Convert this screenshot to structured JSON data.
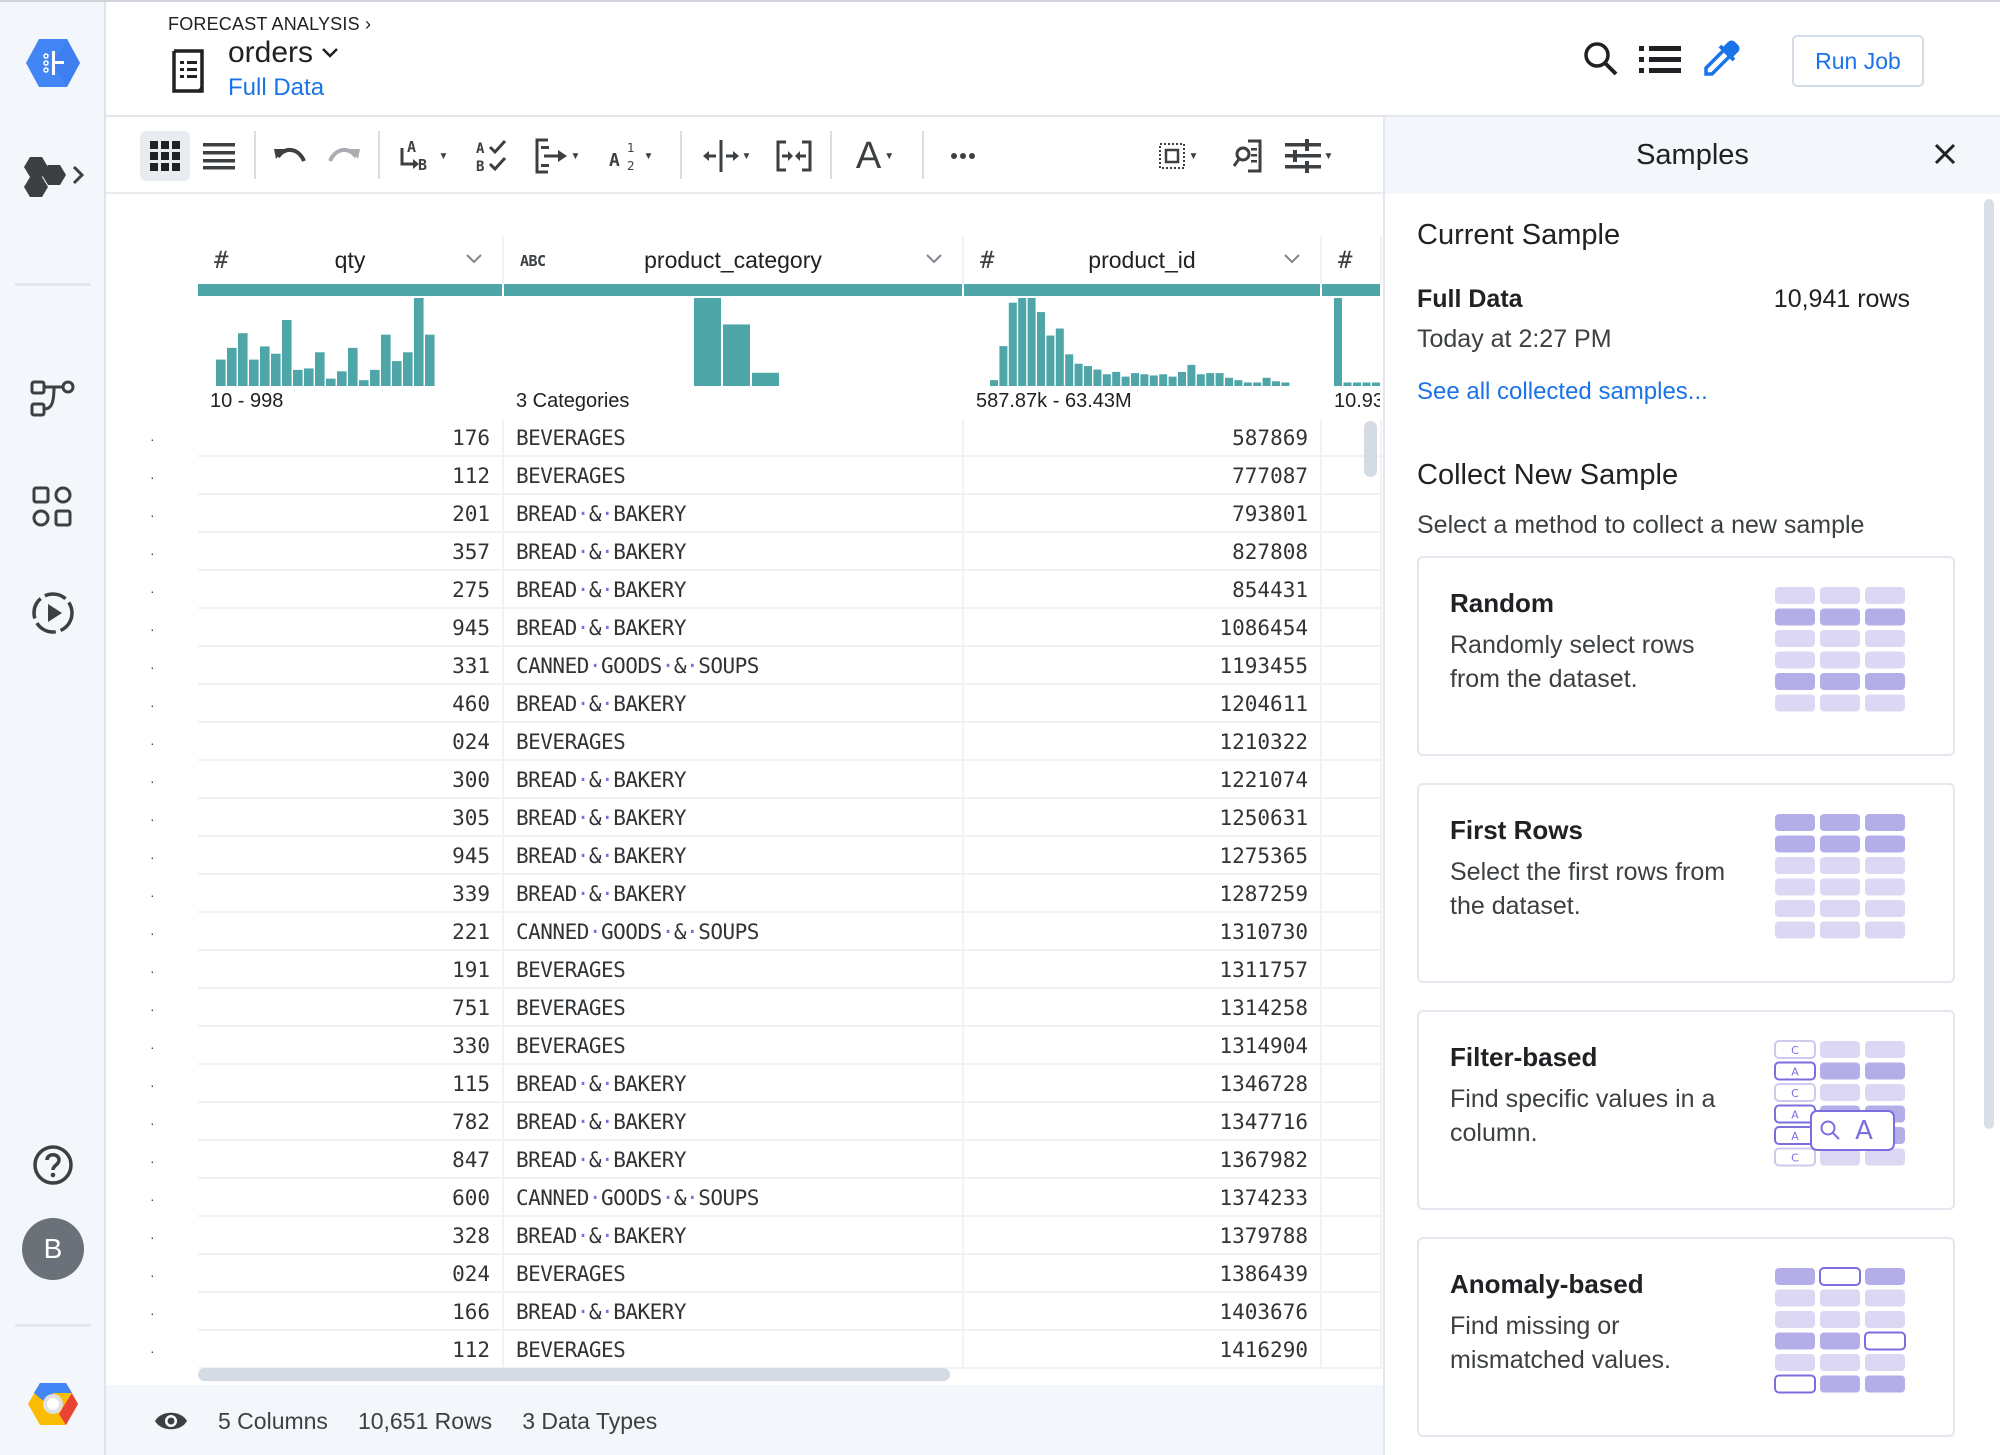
{
  "header": {
    "breadcrumb": "FORECAST ANALYSIS",
    "title": "orders",
    "subtitle": "Full Data",
    "run_job_label": "Run Job"
  },
  "rail": {
    "items": [
      "product-logo",
      "datasets-menu",
      "flows",
      "library",
      "jobs",
      "help",
      "account",
      "cloud-logo"
    ],
    "avatar_initial": "B"
  },
  "toolbar": {
    "items": [
      "grid-view",
      "list-view",
      "undo",
      "redo",
      "rename",
      "validate",
      "merge-columns",
      "sort",
      "split-column",
      "collapse-columns",
      "format-text",
      "more",
      "select",
      "find",
      "settings"
    ]
  },
  "columns": [
    {
      "type_icon": "#",
      "name": "qty",
      "range": "10 - 998"
    },
    {
      "type_icon": "ABC",
      "name": "product_category",
      "range": "3 Categories"
    },
    {
      "type_icon": "#",
      "name": "product_id",
      "range": "587.87k - 63.43M"
    },
    {
      "type_icon": "#",
      "name": "",
      "range": "10.93"
    }
  ],
  "histograms": {
    "qty": [
      18,
      26,
      36,
      18,
      27,
      22,
      45,
      11,
      12,
      23,
      5,
      10,
      26,
      4,
      11,
      35,
      17,
      23,
      60,
      35
    ],
    "product_category": [
      100,
      70,
      15
    ],
    "product_id": [
      5,
      34,
      71,
      75,
      75,
      63,
      43,
      49,
      27,
      19,
      17,
      14,
      10,
      12,
      8,
      11,
      10,
      9,
      10,
      8,
      12,
      18,
      10,
      11,
      11,
      7,
      5,
      3,
      3,
      7,
      4,
      3
    ],
    "col4": [
      100,
      4,
      4,
      4,
      4
    ]
  },
  "rows": [
    {
      "qty": "176",
      "product_category": "BEVERAGES",
      "product_id": "587869"
    },
    {
      "qty": "112",
      "product_category": "BEVERAGES",
      "product_id": "777087"
    },
    {
      "qty": "201",
      "product_category": "BREAD & BAKERY",
      "product_id": "793801"
    },
    {
      "qty": "357",
      "product_category": "BREAD & BAKERY",
      "product_id": "827808"
    },
    {
      "qty": "275",
      "product_category": "BREAD & BAKERY",
      "product_id": "854431"
    },
    {
      "qty": "945",
      "product_category": "BREAD & BAKERY",
      "product_id": "1086454"
    },
    {
      "qty": "331",
      "product_category": "CANNED GOODS & SOUPS",
      "product_id": "1193455"
    },
    {
      "qty": "460",
      "product_category": "BREAD & BAKERY",
      "product_id": "1204611"
    },
    {
      "qty": "024",
      "product_category": "BEVERAGES",
      "product_id": "1210322"
    },
    {
      "qty": "300",
      "product_category": "BREAD & BAKERY",
      "product_id": "1221074"
    },
    {
      "qty": "305",
      "product_category": "BREAD & BAKERY",
      "product_id": "1250631"
    },
    {
      "qty": "945",
      "product_category": "BREAD & BAKERY",
      "product_id": "1275365"
    },
    {
      "qty": "339",
      "product_category": "BREAD & BAKERY",
      "product_id": "1287259"
    },
    {
      "qty": "221",
      "product_category": "CANNED GOODS & SOUPS",
      "product_id": "1310730"
    },
    {
      "qty": "191",
      "product_category": "BEVERAGES",
      "product_id": "1311757"
    },
    {
      "qty": "751",
      "product_category": "BEVERAGES",
      "product_id": "1314258"
    },
    {
      "qty": "330",
      "product_category": "BEVERAGES",
      "product_id": "1314904"
    },
    {
      "qty": "115",
      "product_category": "BREAD & BAKERY",
      "product_id": "1346728"
    },
    {
      "qty": "782",
      "product_category": "BREAD & BAKERY",
      "product_id": "1347716"
    },
    {
      "qty": "847",
      "product_category": "BREAD & BAKERY",
      "product_id": "1367982"
    },
    {
      "qty": "600",
      "product_category": "CANNED GOODS & SOUPS",
      "product_id": "1374233"
    },
    {
      "qty": "328",
      "product_category": "BREAD & BAKERY",
      "product_id": "1379788"
    },
    {
      "qty": "024",
      "product_category": "BEVERAGES",
      "product_id": "1386439"
    },
    {
      "qty": "166",
      "product_category": "BREAD & BAKERY",
      "product_id": "1403676"
    },
    {
      "qty": "112",
      "product_category": "BEVERAGES",
      "product_id": "1416290"
    }
  ],
  "footer": {
    "columns": "5 Columns",
    "rows": "10,651 Rows",
    "types": "3 Data Types"
  },
  "samples": {
    "title": "Samples",
    "current_heading": "Current Sample",
    "current_name": "Full Data",
    "current_rows": "10,941 rows",
    "current_time": "Today at 2:27 PM",
    "see_all_link": "See all collected samples...",
    "collect_heading": "Collect New Sample",
    "collect_sub": "Select a method to collect a new sample",
    "methods": [
      {
        "title": "Random",
        "desc": "Randomly select rows from the dataset.",
        "illus": "random"
      },
      {
        "title": "First Rows",
        "desc": "Select the first rows from the dataset.",
        "illus": "first"
      },
      {
        "title": "Filter-based",
        "desc": "Find specific values in a column.",
        "illus": "filter"
      },
      {
        "title": "Anomaly-based",
        "desc": "Find missing or mismatched values.",
        "illus": "anomaly"
      }
    ]
  },
  "colors": {
    "accent": "#1a73e8",
    "histogram": "#4fa6a8",
    "illus_light": "#dcd8f3",
    "illus_dark": "#b4aee8",
    "illus_stroke": "#7b6fe0"
  }
}
